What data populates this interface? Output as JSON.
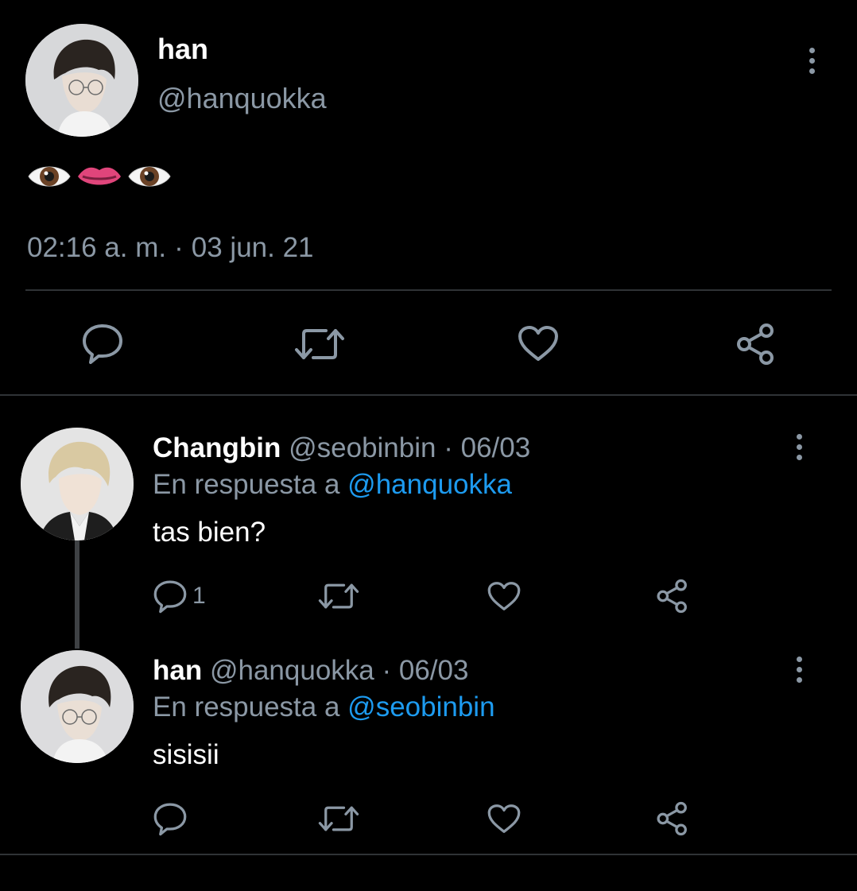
{
  "main_tweet": {
    "author_name": "han",
    "author_handle": "@hanquokka",
    "content_emojis": [
      "eyes-brown-icon",
      "lips-icon",
      "eyes-brown-icon"
    ],
    "time": "02:16 a. m.",
    "separator": "·",
    "date": "03 jun. 21",
    "actions": [
      "reply-icon",
      "retweet-icon",
      "like-icon",
      "share-icon"
    ]
  },
  "replies": [
    {
      "author_name": "Changbin",
      "author_handle": "@seobinbin",
      "date": "· 06/03",
      "reply_prefix": "En respuesta a",
      "reply_to": "@hanquokka",
      "text": "tas bien?",
      "reply_count": "1"
    },
    {
      "author_name": "han",
      "author_handle": "@hanquokka",
      "date": "· 06/03",
      "reply_prefix": "En respuesta a",
      "reply_to": "@seobinbin",
      "text": "sisisii",
      "reply_count": ""
    }
  ],
  "colors": {
    "background": "#000000",
    "primary_text": "#ffffff",
    "secondary_text": "#8b98a5",
    "link": "#1d9bf0",
    "divider": "#2f3336"
  }
}
